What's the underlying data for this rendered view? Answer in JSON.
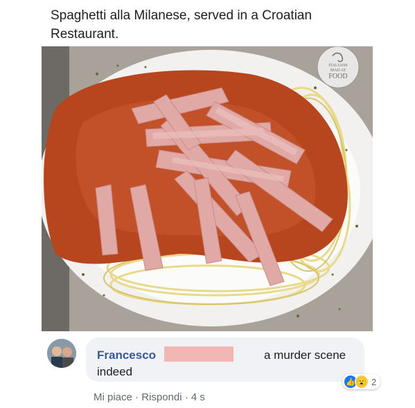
{
  "post": {
    "caption": "Spaghetti alla Milanese, served in a Croatian Restaurant."
  },
  "watermark": {
    "line1": "ITALIANS",
    "line2": "MAD AT",
    "line3": "FOOD"
  },
  "comment": {
    "author": "Francesco",
    "text_part1": "a murder scene",
    "text_part2": "indeed",
    "actions": {
      "like": "Mi piace",
      "sep1": " · ",
      "reply": "Rispondi",
      "sep2": " · ",
      "time": "4 s"
    },
    "reactions": {
      "icons": [
        "like-icon",
        "wow-icon"
      ],
      "count": "2"
    }
  },
  "colors": {
    "author": "#385898",
    "bubble": "#f0f2f5",
    "redaction": "#f2b6b4",
    "like": "#1877f2"
  }
}
